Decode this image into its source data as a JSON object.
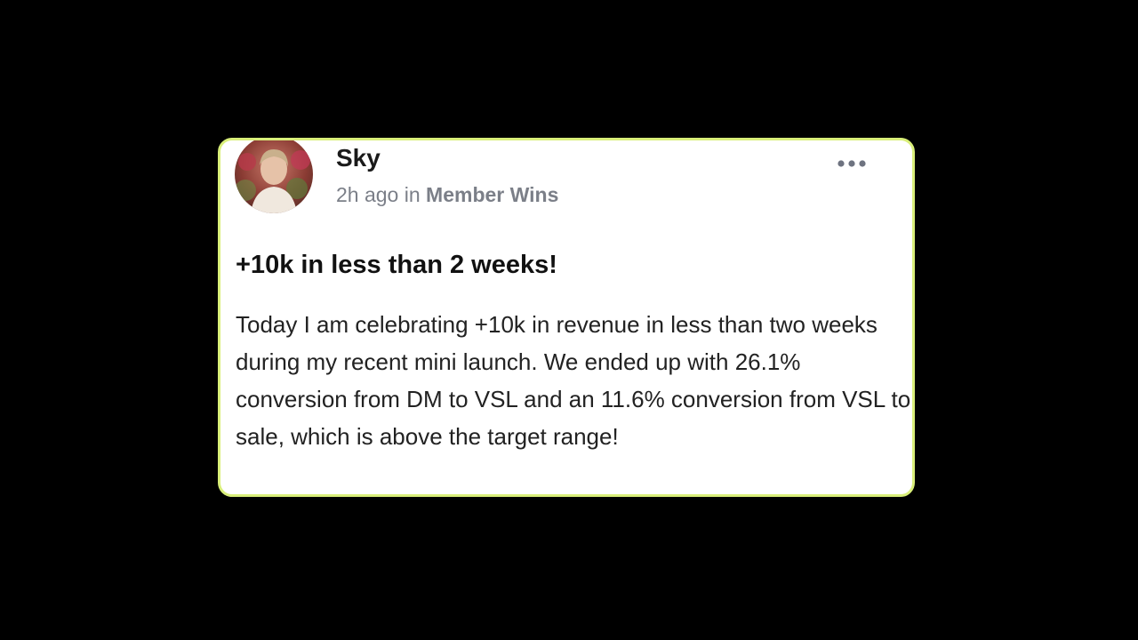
{
  "post": {
    "author": {
      "name": "Sky",
      "avatar_icon": "profile-photo"
    },
    "meta": {
      "time": "2h ago",
      "in_word": "in",
      "category": "Member Wins"
    },
    "more_icon": "more-horizontal-icon",
    "title": "+10k in less than 2 weeks!",
    "body": "Today I am celebrating +10k in revenue in less than two weeks during my recent mini launch. We ended up with 26.1% conversion from DM to VSL and an 11.6% conversion from VSL to sale, which is above the target range!"
  },
  "colors": {
    "background": "#000000",
    "card": "#ffffff",
    "card_border": "#d9ef7a",
    "meta_text": "#7b7f88",
    "title_text": "#111111"
  }
}
